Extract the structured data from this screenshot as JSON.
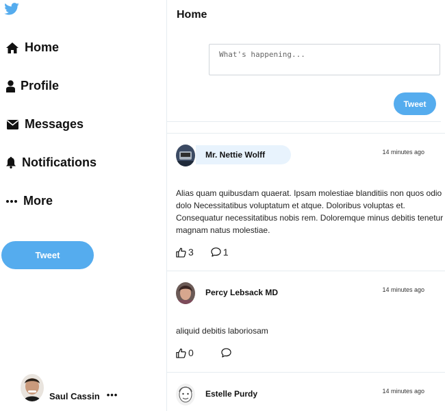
{
  "brand": {
    "logo_icon": "twitter-bird-icon",
    "color": "#55acee"
  },
  "sidebar": {
    "items": [
      {
        "label": "Home",
        "icon": "home-icon"
      },
      {
        "label": "Profile",
        "icon": "user-icon"
      },
      {
        "label": "Messages",
        "icon": "envelope-icon"
      },
      {
        "label": "Notifications",
        "icon": "bell-icon"
      },
      {
        "label": "More",
        "icon": "ellipsis-icon"
      }
    ],
    "tweet_button": "Tweet",
    "user": {
      "name": "Saul Cassin",
      "more": "•••"
    }
  },
  "main": {
    "title": "Home",
    "composer": {
      "placeholder": "What's happening...",
      "button": "Tweet"
    },
    "tweets": [
      {
        "author": "Mr. Nettie Wolff",
        "time": "14 minutes ago",
        "text": "Alias quam quibusdam quaerat. Ipsam molestiae blanditiis non quos odio dolo Necessitatibus voluptatum et atque. Doloribus voluptas et. Consequatur necessitatibus nobis rem. Doloremque minus debitis tenetur magnam natus molestiae.",
        "likes": "3",
        "comments": "1"
      },
      {
        "author": "Percy Lebsack MD",
        "time": "14 minutes ago",
        "text": "aliquid debitis laboriosam",
        "likes": "0",
        "comments": ""
      },
      {
        "author": "Estelle Purdy",
        "time": "14 minutes ago"
      }
    ]
  }
}
